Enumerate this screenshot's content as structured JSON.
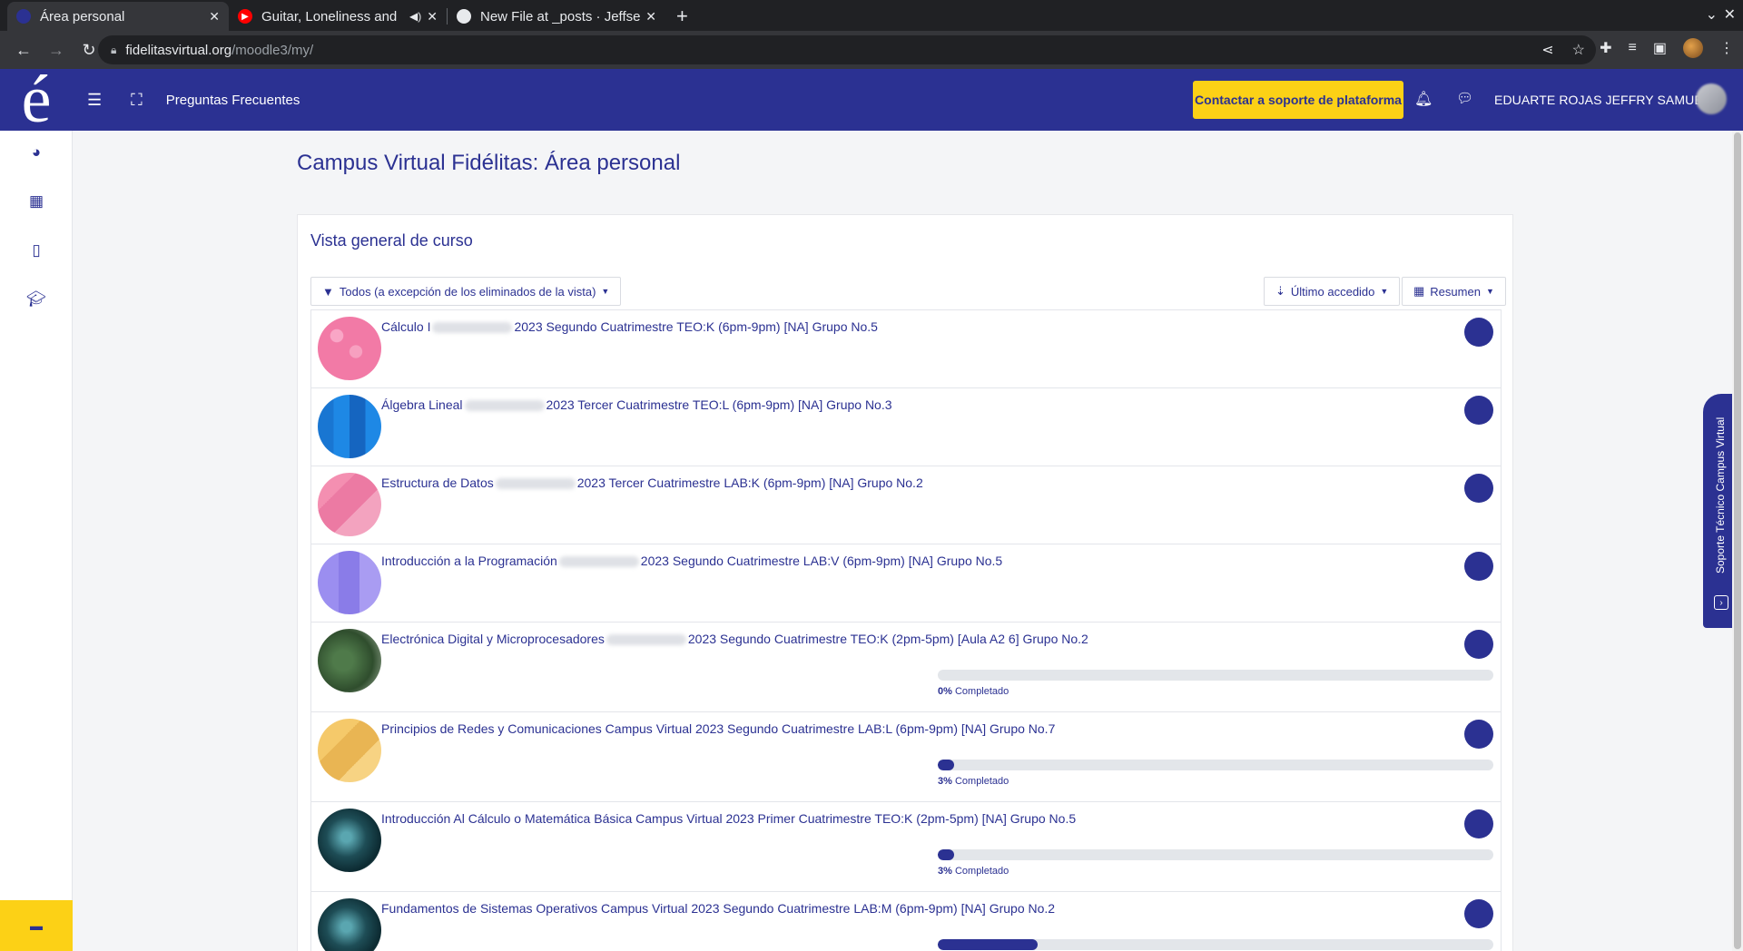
{
  "browser": {
    "tabs": [
      {
        "title": "Área personal",
        "active": true,
        "favicon": "moodle-favicon"
      },
      {
        "title": "Guitar, Loneliness and",
        "active": false,
        "favicon": "youtube-icon",
        "audio": true
      },
      {
        "title": "New File at _posts · Jeffse",
        "active": false,
        "favicon": "github-icon"
      }
    ],
    "new_tab_label": "+",
    "url_host": "fidelitasvirtual.org",
    "url_path": "/moodle3/my/"
  },
  "header": {
    "logo": "é",
    "menu_link": "Preguntas Frecuentes",
    "support_button": "Contactar a soporte de plataforma",
    "username": "EDUARTE ROJAS JEFFRY SAMUEL",
    "brand_color": "#2b3192",
    "accent_color": "#fcd116"
  },
  "left_nav": {
    "icons": [
      "dashboard-icon",
      "calendar-icon",
      "file-icon",
      "graduation-cap-icon"
    ],
    "bottom_icon": "archive-icon"
  },
  "page_title": "Campus Virtual Fidélitas: Área personal",
  "overview": {
    "title": "Vista general de curso",
    "filter_label": "Todos (a excepción de los eliminados de la vista)",
    "sort_label": "Último accedido",
    "view_label": "Resumen"
  },
  "courses": [
    {
      "name_start": "Cálculo I",
      "name_end": "2023 Segundo Cuatrimestre TEO:K (6pm-9pm) [NA] Grupo No.5",
      "blurred": true,
      "progress": null
    },
    {
      "name_start": "Álgebra Lineal",
      "name_end": "2023 Tercer Cuatrimestre TEO:L (6pm-9pm) [NA] Grupo No.3",
      "blurred": true,
      "progress": null
    },
    {
      "name_start": "Estructura de Datos",
      "name_end": "2023 Tercer Cuatrimestre LAB:K (6pm-9pm) [NA] Grupo No.2",
      "blurred": true,
      "progress": null
    },
    {
      "name_start": "Introducción a la Programación",
      "name_end": "2023 Segundo Cuatrimestre LAB:V (6pm-9pm) [NA] Grupo No.5",
      "blurred": true,
      "progress": null
    },
    {
      "name_start": "Electrónica Digital y Microprocesadores",
      "name_end": "2023 Segundo Cuatrimestre TEO:K (2pm-5pm) [Aula A2 6] Grupo No.2",
      "blurred": true,
      "progress": 0,
      "progress_pct": "0%",
      "progress_word": "Completado"
    },
    {
      "name_start": "Principios de Redes y Comunicaciones Campus Virtual 2023 Segundo Cuatrimestre LAB:L (6pm-9pm) [NA] Grupo No.7",
      "name_end": "",
      "blurred": false,
      "progress": 3,
      "progress_pct": "3%",
      "progress_word": "Completado"
    },
    {
      "name_start": "Introducción Al Cálculo o Matemática Básica Campus Virtual 2023 Primer Cuatrimestre TEO:K (2pm-5pm) [NA] Grupo No.5",
      "name_end": "",
      "blurred": false,
      "progress": 3,
      "progress_pct": "3%",
      "progress_word": "Completado"
    },
    {
      "name_start": "Fundamentos de Sistemas Operativos Campus Virtual 2023 Segundo Cuatrimestre LAB:M (6pm-9pm) [NA] Grupo No.2",
      "name_end": "",
      "blurred": false,
      "progress": 18,
      "progress_pct": "",
      "progress_word": ""
    }
  ],
  "side_tab": {
    "label": "Soporte Técnico Campus Virtual"
  }
}
